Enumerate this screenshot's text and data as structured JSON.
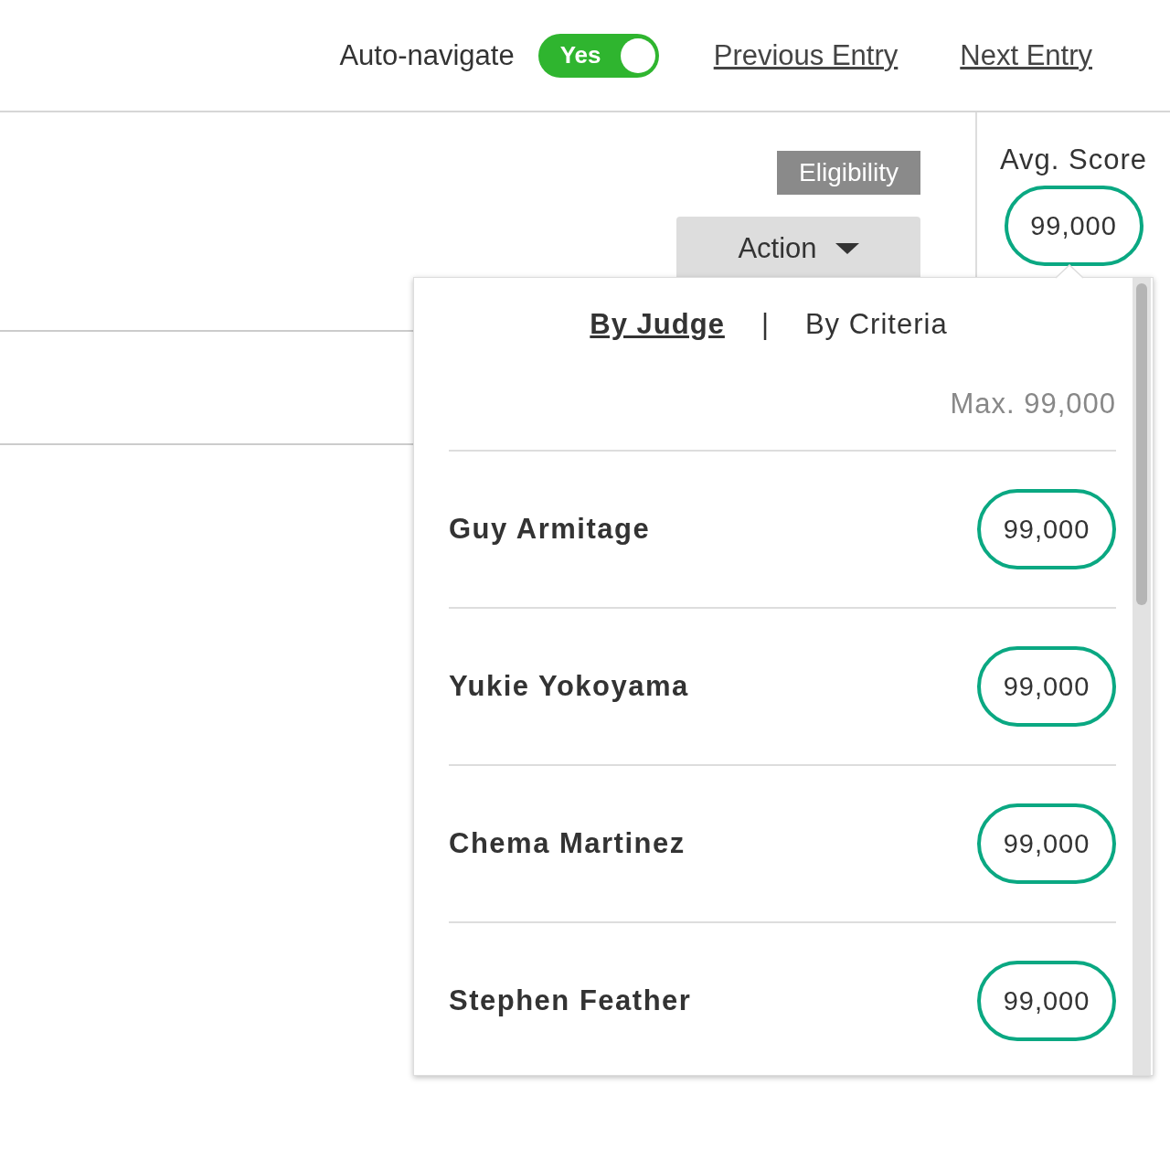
{
  "header": {
    "auto_navigate": {
      "label": "Auto-navigate",
      "on": true,
      "value": "Yes"
    },
    "links": [
      "Previous Entry",
      "Next Entry"
    ]
  },
  "eligibility": "Eligibility",
  "action": "Action",
  "avg_score": {
    "label": "Avg. Score",
    "value": "99,000"
  },
  "popover": {
    "tabs": [
      {
        "label": "By Judge",
        "selected": true
      },
      {
        "label": "By Criteria",
        "selected": false
      }
    ],
    "separator": "|",
    "max": "Max. 99,000",
    "judges": [
      {
        "name": "Guy Armitage",
        "score": "99,000"
      },
      {
        "name": "Yukie Yokoyama",
        "score": "99,000"
      },
      {
        "name": "Chema Martinez",
        "score": "99,000"
      },
      {
        "name": "Stephen Feather",
        "score": "99,000"
      }
    ]
  }
}
